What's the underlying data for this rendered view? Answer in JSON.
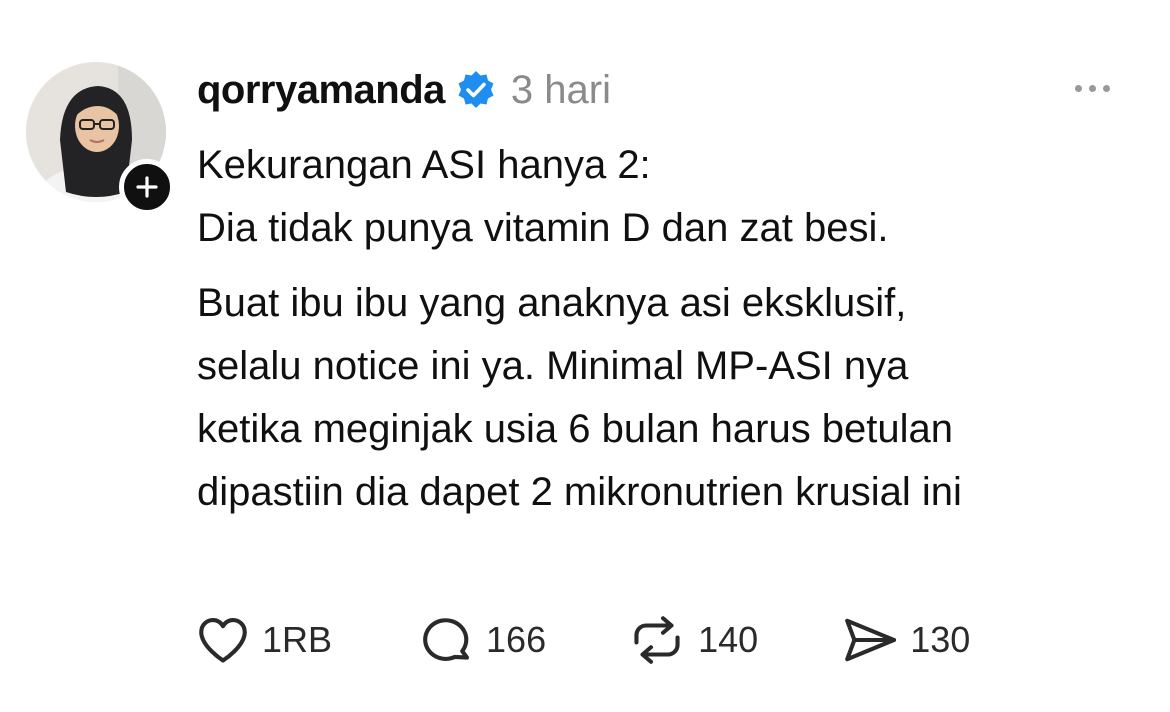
{
  "post": {
    "username": "qorryamanda",
    "time": "3 hari",
    "text_lines_1": [
      "Kekurangan ASI hanya 2:",
      "Dia tidak punya vitamin D dan zat besi."
    ],
    "text_lines_2": [
      "Buat ibu ibu yang anaknya asi eksklusif,",
      "selalu notice ini ya. Minimal MP-ASI nya",
      "ketika meginjak usia 6 bulan harus betulan",
      "dipastiin dia dapet 2 mikronutrien krusial ini"
    ]
  },
  "actions": {
    "likes": "1RB",
    "replies": "166",
    "reposts": "140",
    "shares": "130"
  },
  "icons": {
    "verified": "verified-badge-icon",
    "follow": "plus-icon",
    "more": "more-horizontal-icon",
    "like": "heart-icon",
    "reply": "comment-bubble-icon",
    "repost": "repost-icon",
    "share": "send-icon"
  },
  "colors": {
    "verified_blue": "#1f8ef1",
    "text": "#101010",
    "muted": "#8a8a8a"
  }
}
